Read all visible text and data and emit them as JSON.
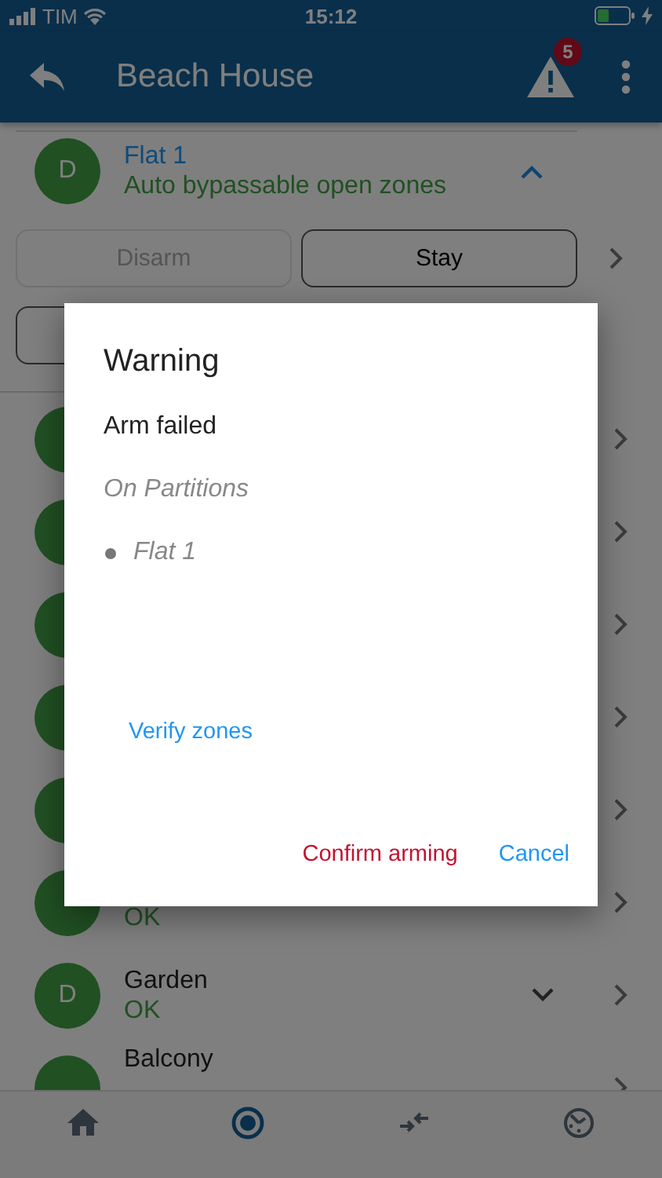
{
  "status_bar": {
    "carrier": "TIM",
    "time": "15:12"
  },
  "header": {
    "title": "Beach House",
    "alert_count": "5"
  },
  "partition": {
    "avatar": "D",
    "name": "Flat 1",
    "status": "Auto bypassable open zones",
    "expanded": true
  },
  "arm_buttons": [
    {
      "label": "Disarm",
      "disabled": true,
      "selected": false
    },
    {
      "label": "Stay",
      "disabled": false,
      "selected": true
    }
  ],
  "zones": [
    {
      "kind": "covered"
    },
    {
      "kind": "covered"
    },
    {
      "kind": "covered"
    },
    {
      "kind": "covered"
    },
    {
      "kind": "covered"
    },
    {
      "kind": "zone",
      "status": "OK"
    },
    {
      "kind": "zone",
      "avatar": "D",
      "name": "Garden",
      "status": "OK",
      "expanded": false
    },
    {
      "kind": "zone",
      "name": "Balcony"
    }
  ],
  "dialog": {
    "title": "Warning",
    "message": "Arm failed",
    "subtitle": "On Partitions",
    "partitions": [
      "Flat 1"
    ],
    "link": "Verify zones",
    "actions": [
      {
        "label": "Confirm arming",
        "kind": "confirm"
      },
      {
        "label": "Cancel",
        "kind": "cancel"
      }
    ]
  },
  "nav": [
    {
      "selected": false
    },
    {
      "selected": true
    },
    {
      "selected": false
    },
    {
      "selected": false
    }
  ]
}
